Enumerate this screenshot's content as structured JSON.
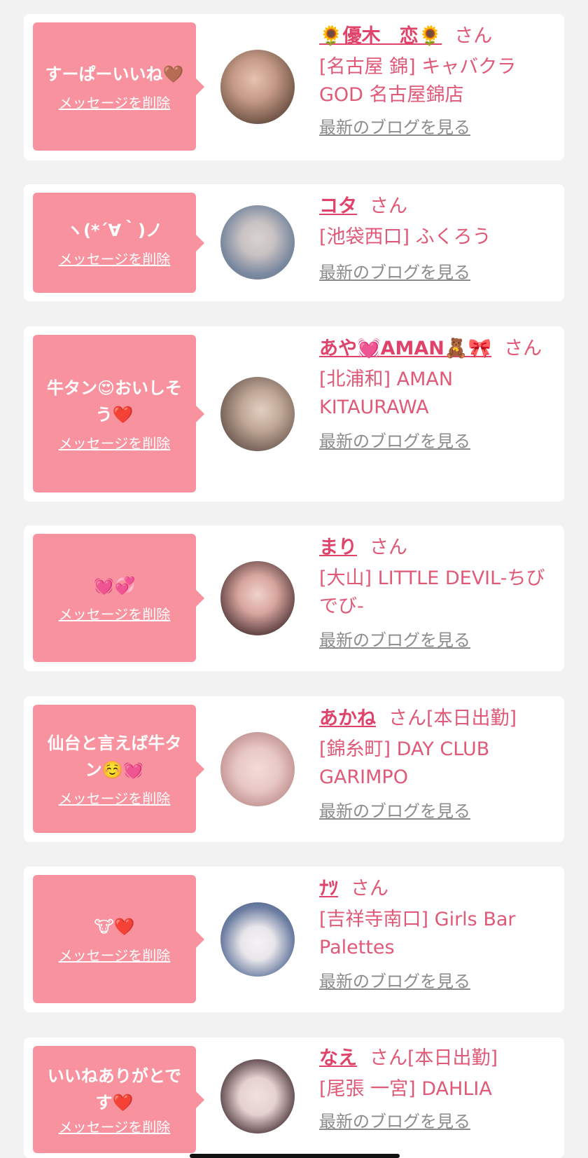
{
  "theme": {
    "bubble_color": "#f7929e",
    "accent_text": "#e05a78",
    "name_color": "#e0436a",
    "blog_link_color": "#8c8c8c",
    "background": "#f2f2f2"
  },
  "items": [
    {
      "message": "すーぱーいいね🤎",
      "delete_label": "メッセージを削除",
      "name": "🌻優木　恋🌻",
      "suffix": "さん",
      "status": "",
      "shop": "[名古屋 錦] キャバクラGOD 名古屋錦店",
      "blog_label": "最新のブログを見る",
      "avatar_colors": [
        "#6e5346",
        "#c59a86"
      ]
    },
    {
      "message": "ヽ(*´∀｀)ノ",
      "delete_label": "メッセージを削除",
      "name": "コタ",
      "suffix": "さん",
      "status": "",
      "shop": "[池袋西口] ふくろう",
      "blog_label": "最新のブログを見る",
      "avatar_colors": [
        "#5a6e8a",
        "#c9c2c3"
      ]
    },
    {
      "message": "牛タン😍おいしそう❤️",
      "delete_label": "メッセージを削除",
      "name": "あや💓AMAN🧸🎀",
      "suffix": "さん",
      "status": "",
      "shop": "[北浦和] AMAN KITAURAWA",
      "blog_label": "最新のブログを見る",
      "avatar_colors": [
        "#4d413c",
        "#bfa796"
      ]
    },
    {
      "message": "💓💞",
      "delete_label": "メッセージを削除",
      "name": "まり",
      "suffix": "さん",
      "status": "",
      "shop": "[大山] LITTLE DEVIL-ちびでび-",
      "blog_label": "最新のブログを見る",
      "avatar_colors": [
        "#2e2324",
        "#d7a59e"
      ]
    },
    {
      "message": "仙台と言えば牛タン☺️💓",
      "delete_label": "メッセージを削除",
      "name": "あかね",
      "suffix": "さん",
      "status": "[本日出勤]",
      "shop": "[錦糸町] DAY CLUB GARIMPO",
      "blog_label": "最新のブログを見る",
      "avatar_colors": [
        "#e8c8c6",
        "#b98684"
      ]
    },
    {
      "message": "🐮❤️",
      "delete_label": "メッセージを削除",
      "name": "ﾅﾂ",
      "suffix": "さん",
      "status": "",
      "shop": "[吉祥寺南口] Girls Bar Palettes",
      "blog_label": "最新のブログを見る",
      "avatar_colors": [
        "#2f4b7a",
        "#e8e6ea"
      ]
    },
    {
      "message": "いいねありがとです❤️",
      "delete_label": "メッセージを削除",
      "name": "なえ",
      "suffix": "さん",
      "status": "[本日出勤]",
      "shop": "[尾張 一宮] DAHLIA",
      "blog_label": "最新のブログを見る",
      "avatar_colors": [
        "#2a2226",
        "#e5d2d0"
      ]
    }
  ]
}
